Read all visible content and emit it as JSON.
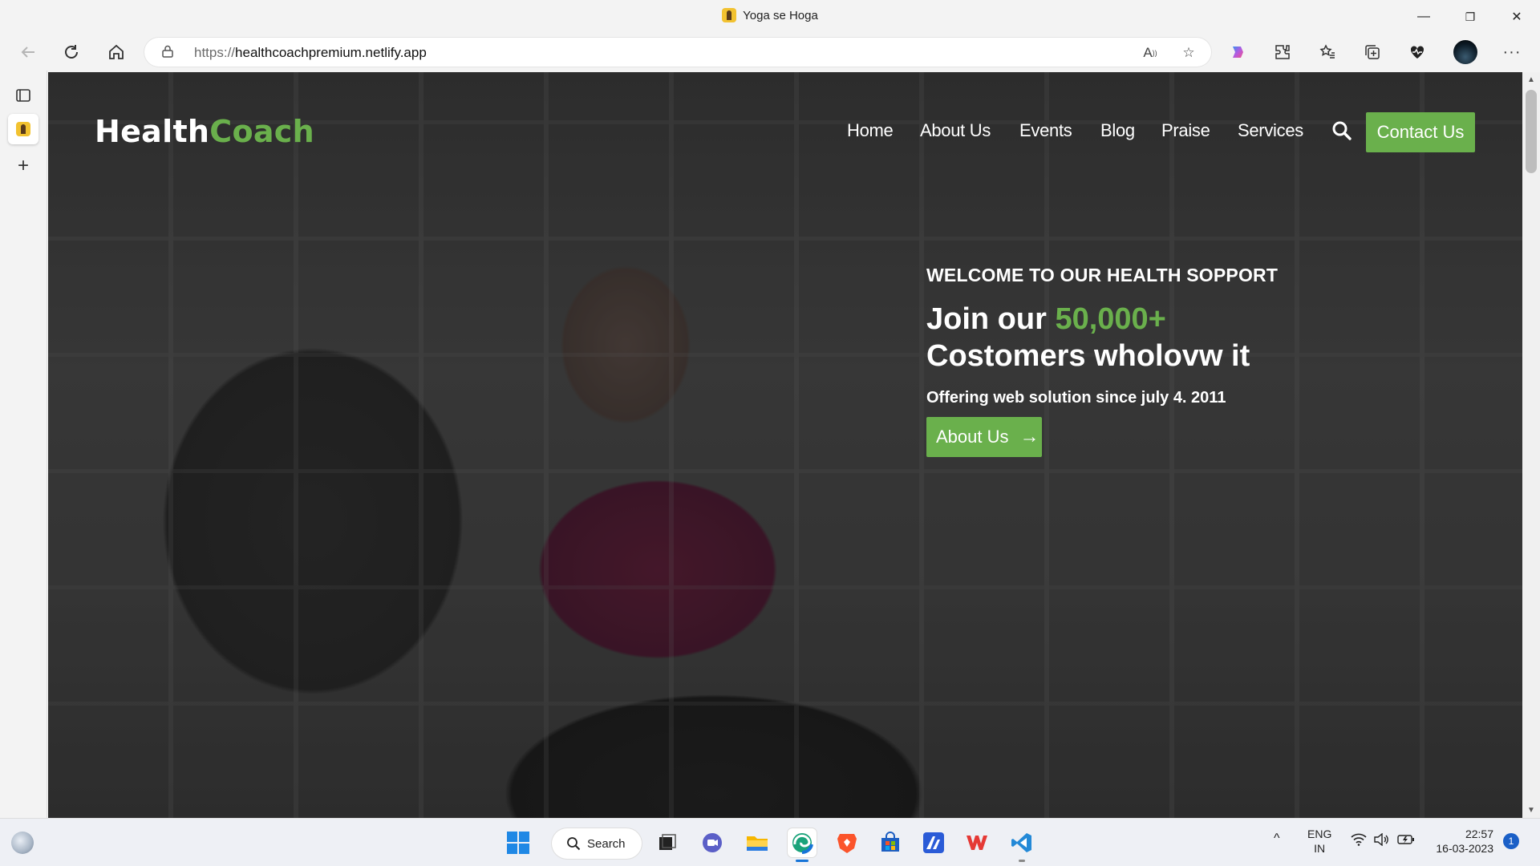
{
  "window": {
    "title": "Yoga se Hoga",
    "minimize_glyph": "—",
    "restore_glyph": "❐",
    "close_glyph": "✕"
  },
  "browser": {
    "url_prefix": "https://",
    "url_host": "healthcoachpremium.netlify.app",
    "icons": [
      "back-icon",
      "refresh-icon",
      "home-icon",
      "lock-icon",
      "read-aloud-icon",
      "add-favorite-icon",
      "copilot-icon",
      "extensions-icon",
      "favorites-icon",
      "collections-icon",
      "browser-essentials-icon",
      "profile-avatar",
      "more-icon"
    ]
  },
  "site": {
    "logo_main": "Health",
    "logo_accent": "Coach",
    "nav": [
      "Home",
      "About Us",
      "Events",
      "Blog",
      "Praise",
      "Services"
    ],
    "contact_label": "Contact Us",
    "hero": {
      "subtitle": "WELCOME TO OUR HEALTH SOPPORT",
      "title_pre": "Join our ",
      "title_highlight": "50,000+",
      "title_line2": "Costomers wholovw it",
      "tagline": "Offering web solution since july 4. 2011",
      "button_label": "About Us",
      "button_arrow": "→"
    },
    "accent_color": "#6ab04c"
  },
  "taskbar": {
    "search_label": "Search",
    "lang_top": "ENG",
    "lang_bottom": "IN",
    "time": "22:57",
    "date": "16-03-2023",
    "notification_count": "1",
    "tray_up": "^"
  }
}
